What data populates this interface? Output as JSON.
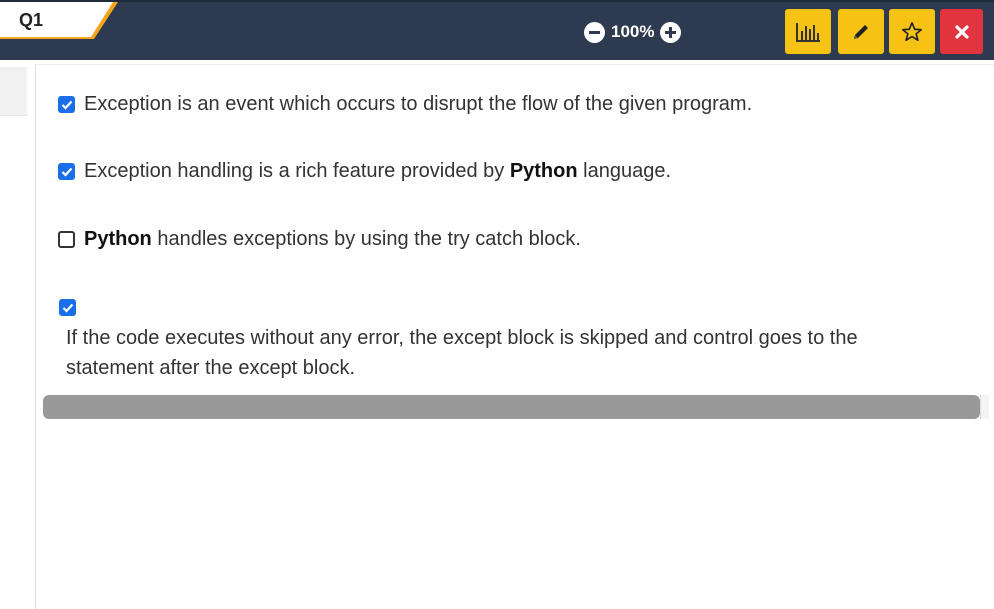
{
  "header": {
    "question_label": "Q1",
    "zoom_level": "100%",
    "buttons": {
      "stats": "bar-chart-icon",
      "edit": "pencil-icon",
      "favorite": "star-icon",
      "close": "close-icon"
    }
  },
  "colors": {
    "topbar": "#2d3a50",
    "accent": "#f6c314",
    "close": "#e2343f",
    "checkbox": "#1a6fe8"
  },
  "options": [
    {
      "checked": true,
      "text_before": "Exception is an event which occurs to disrupt the flow of the given program.",
      "bold": "",
      "text_after": ""
    },
    {
      "checked": true,
      "text_before": "Exception handling is a rich feature provided by ",
      "bold": "Python",
      "text_after": " language."
    },
    {
      "checked": false,
      "text_before": "",
      "bold": "Python",
      "text_after": " handles exceptions by using the try catch block."
    },
    {
      "checked": true,
      "text": "If the code executes without any error, the except block is skipped and control goes to the statement after the except block."
    }
  ]
}
